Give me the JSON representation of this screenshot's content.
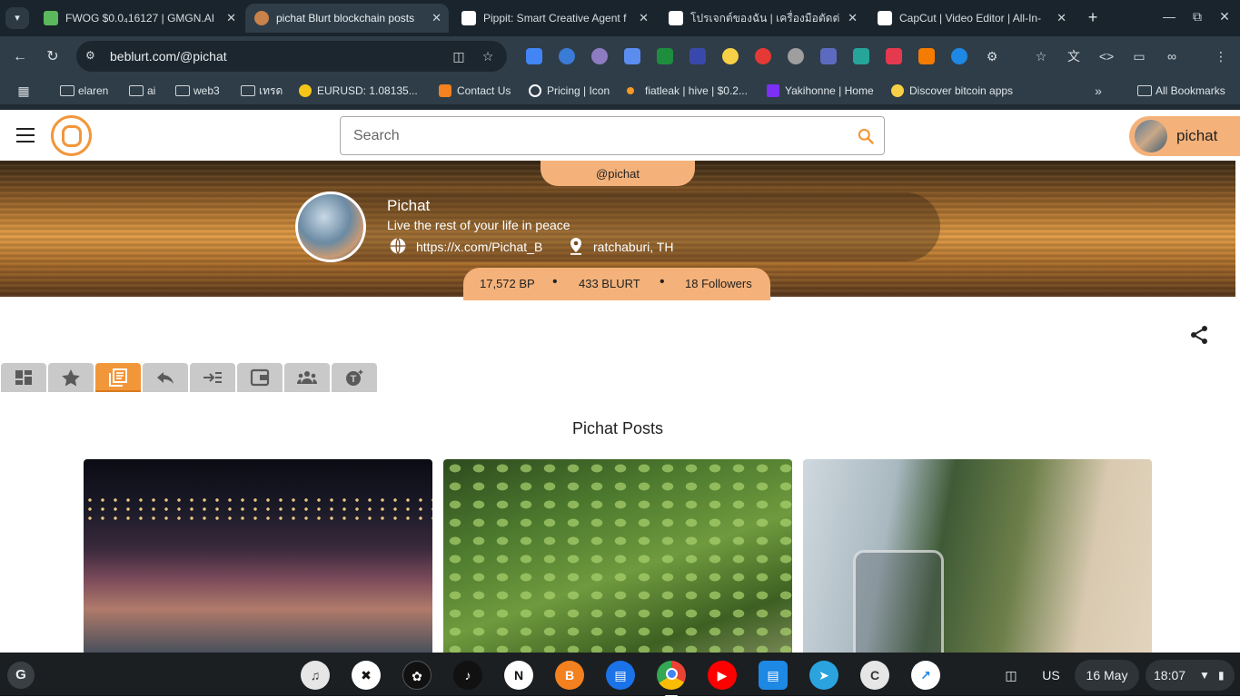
{
  "browser": {
    "tabs": [
      {
        "title": "FWOG $0.0₄16127 | GMGN.AI",
        "favicon_color": "#5cb85c",
        "active": false
      },
      {
        "title": "pichat Blurt blockchain posts",
        "favicon_color": "#c8824a",
        "active": true
      },
      {
        "title": "Pippit: Smart Creative Agent f",
        "favicon_color": "#ffffff",
        "active": false
      },
      {
        "title": "โปรเจกต์ของฉัน | เครื่องมือตัดต่อ",
        "favicon_color": "#ffffff",
        "active": false
      },
      {
        "title": "CapCut | Video Editor | All-In-",
        "favicon_color": "#ffffff",
        "active": false
      }
    ],
    "tab_search_icon": "chevron-down-icon",
    "new_tab_icon": "plus-icon",
    "url": "beblurt.com/@pichat",
    "bookmarks": [
      {
        "label": "elaren",
        "type": "folder"
      },
      {
        "label": "ai",
        "type": "folder"
      },
      {
        "label": "web3",
        "type": "folder"
      },
      {
        "label": "เทรด",
        "type": "folder"
      },
      {
        "label": "EURUSD: 1.08135...",
        "type": "link",
        "color": "#f5c518"
      },
      {
        "label": "Contact Us",
        "type": "link",
        "color": "#f4811f"
      },
      {
        "label": "Pricing | Icon",
        "type": "link",
        "color": "#ffffff"
      },
      {
        "label": "fiatleak | hive | $0.2...",
        "type": "link",
        "color": "#f59a23"
      },
      {
        "label": "Yakihonne | Home",
        "type": "link",
        "color": "#7b2ff7"
      },
      {
        "label": "Discover bitcoin apps",
        "type": "link",
        "color": "#f7d046"
      }
    ],
    "all_bookmarks": "All Bookmarks"
  },
  "site": {
    "search_placeholder": "Search",
    "user_chip": "pichat",
    "accent": "#f4b27a",
    "brand": "#f2963a"
  },
  "profile": {
    "handle": "@pichat",
    "name": "Pichat",
    "about": "Live the rest of your life in peace",
    "website": "https://x.com/Pichat_B",
    "location": "ratchaburi, TH",
    "stats": {
      "bp": "17,572 BP",
      "blurt": "433 BLURT",
      "followers": "18 Followers"
    }
  },
  "profile_tabs": [
    {
      "name": "tab-dashboard",
      "icon": "dashboard-icon"
    },
    {
      "name": "tab-favorites",
      "icon": "star-icon"
    },
    {
      "name": "tab-posts",
      "icon": "posts-icon",
      "active": true
    },
    {
      "name": "tab-replies",
      "icon": "reply-icon"
    },
    {
      "name": "tab-activity",
      "icon": "activity-icon"
    },
    {
      "name": "tab-wallet",
      "icon": "wallet-icon"
    },
    {
      "name": "tab-community",
      "icon": "community-icon"
    },
    {
      "name": "tab-tokens",
      "icon": "token-icon"
    }
  ],
  "posts_section_title": "Pichat Posts",
  "posts": [
    {
      "image": "night festival stage with lights and crowd"
    },
    {
      "image": "green leafy plants"
    },
    {
      "image": "glass jug on table with plants and window"
    }
  ],
  "shelf": {
    "launcher": "G",
    "apps": [
      "apple-music",
      "capcut",
      "chatgpt",
      "tiktok",
      "notion",
      "blogger",
      "news",
      "chrome",
      "youtube",
      "files",
      "telegram",
      "cursor",
      "stocks"
    ],
    "keyboard": "US",
    "date": "16 May",
    "time": "18:07"
  }
}
